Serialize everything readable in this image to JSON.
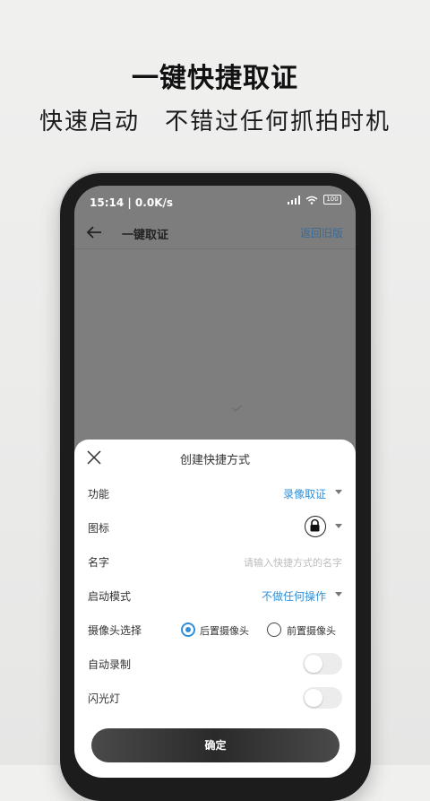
{
  "promo": {
    "headline": "一键快捷取证",
    "subline": "快速启动　不错过任何抓拍时机"
  },
  "status_bar": {
    "time": "15:14 | 0.0K/s",
    "battery": "100"
  },
  "app_bar": {
    "title": "一键取证",
    "old_version_link": "返回旧版"
  },
  "sheet": {
    "title": "创建快捷方式",
    "rows": {
      "function": {
        "label": "功能",
        "value": "录像取证"
      },
      "icon": {
        "label": "图标",
        "icon_name": "lock-icon"
      },
      "name": {
        "label": "名字",
        "placeholder": "请输入快捷方式的名字"
      },
      "launch_mode": {
        "label": "启动模式",
        "value": "不做任何操作"
      },
      "camera": {
        "label": "摄像头选择",
        "options": [
          "后置摄像头",
          "前置摄像头"
        ],
        "selected": "后置摄像头"
      },
      "auto_record": {
        "label": "自动录制",
        "on": false
      },
      "flash": {
        "label": "闪光灯",
        "on": false
      }
    },
    "confirm_label": "确定"
  },
  "colors": {
    "accent": "#2f8fd8",
    "link": "#3a6a97"
  }
}
